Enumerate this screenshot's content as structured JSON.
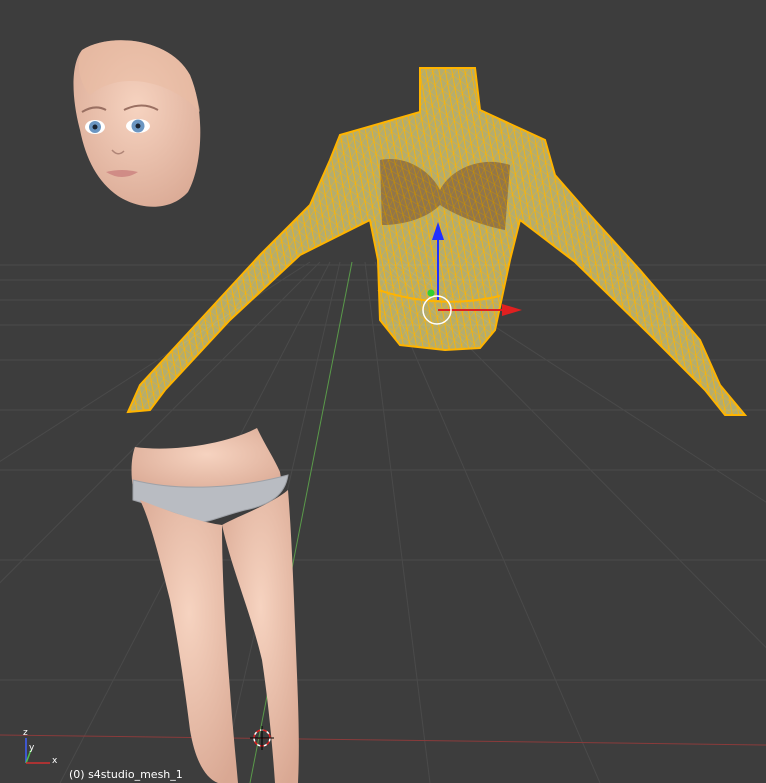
{
  "viewport": {
    "object_label": "(0) s4studio_mesh_1",
    "background_color": "#3d3d3d",
    "grid_color": "#4a4a4a",
    "selection_color": "#ffb400"
  },
  "axis_gizmo": {
    "x_label": "x",
    "y_label": "y",
    "z_label": "z",
    "x_color": "#d03030",
    "y_color": "#50c050",
    "z_color": "#4060ff"
  },
  "transform_manipulator": {
    "x_arrow_color": "#e02020",
    "z_arrow_color": "#2030ff",
    "center_dot_color": "#30d030"
  },
  "objects": [
    {
      "name": "head-mesh",
      "selected": false
    },
    {
      "name": "top-mesh",
      "selected": true,
      "display": "wireframe"
    },
    {
      "name": "bottom-mesh",
      "selected": false
    }
  ]
}
